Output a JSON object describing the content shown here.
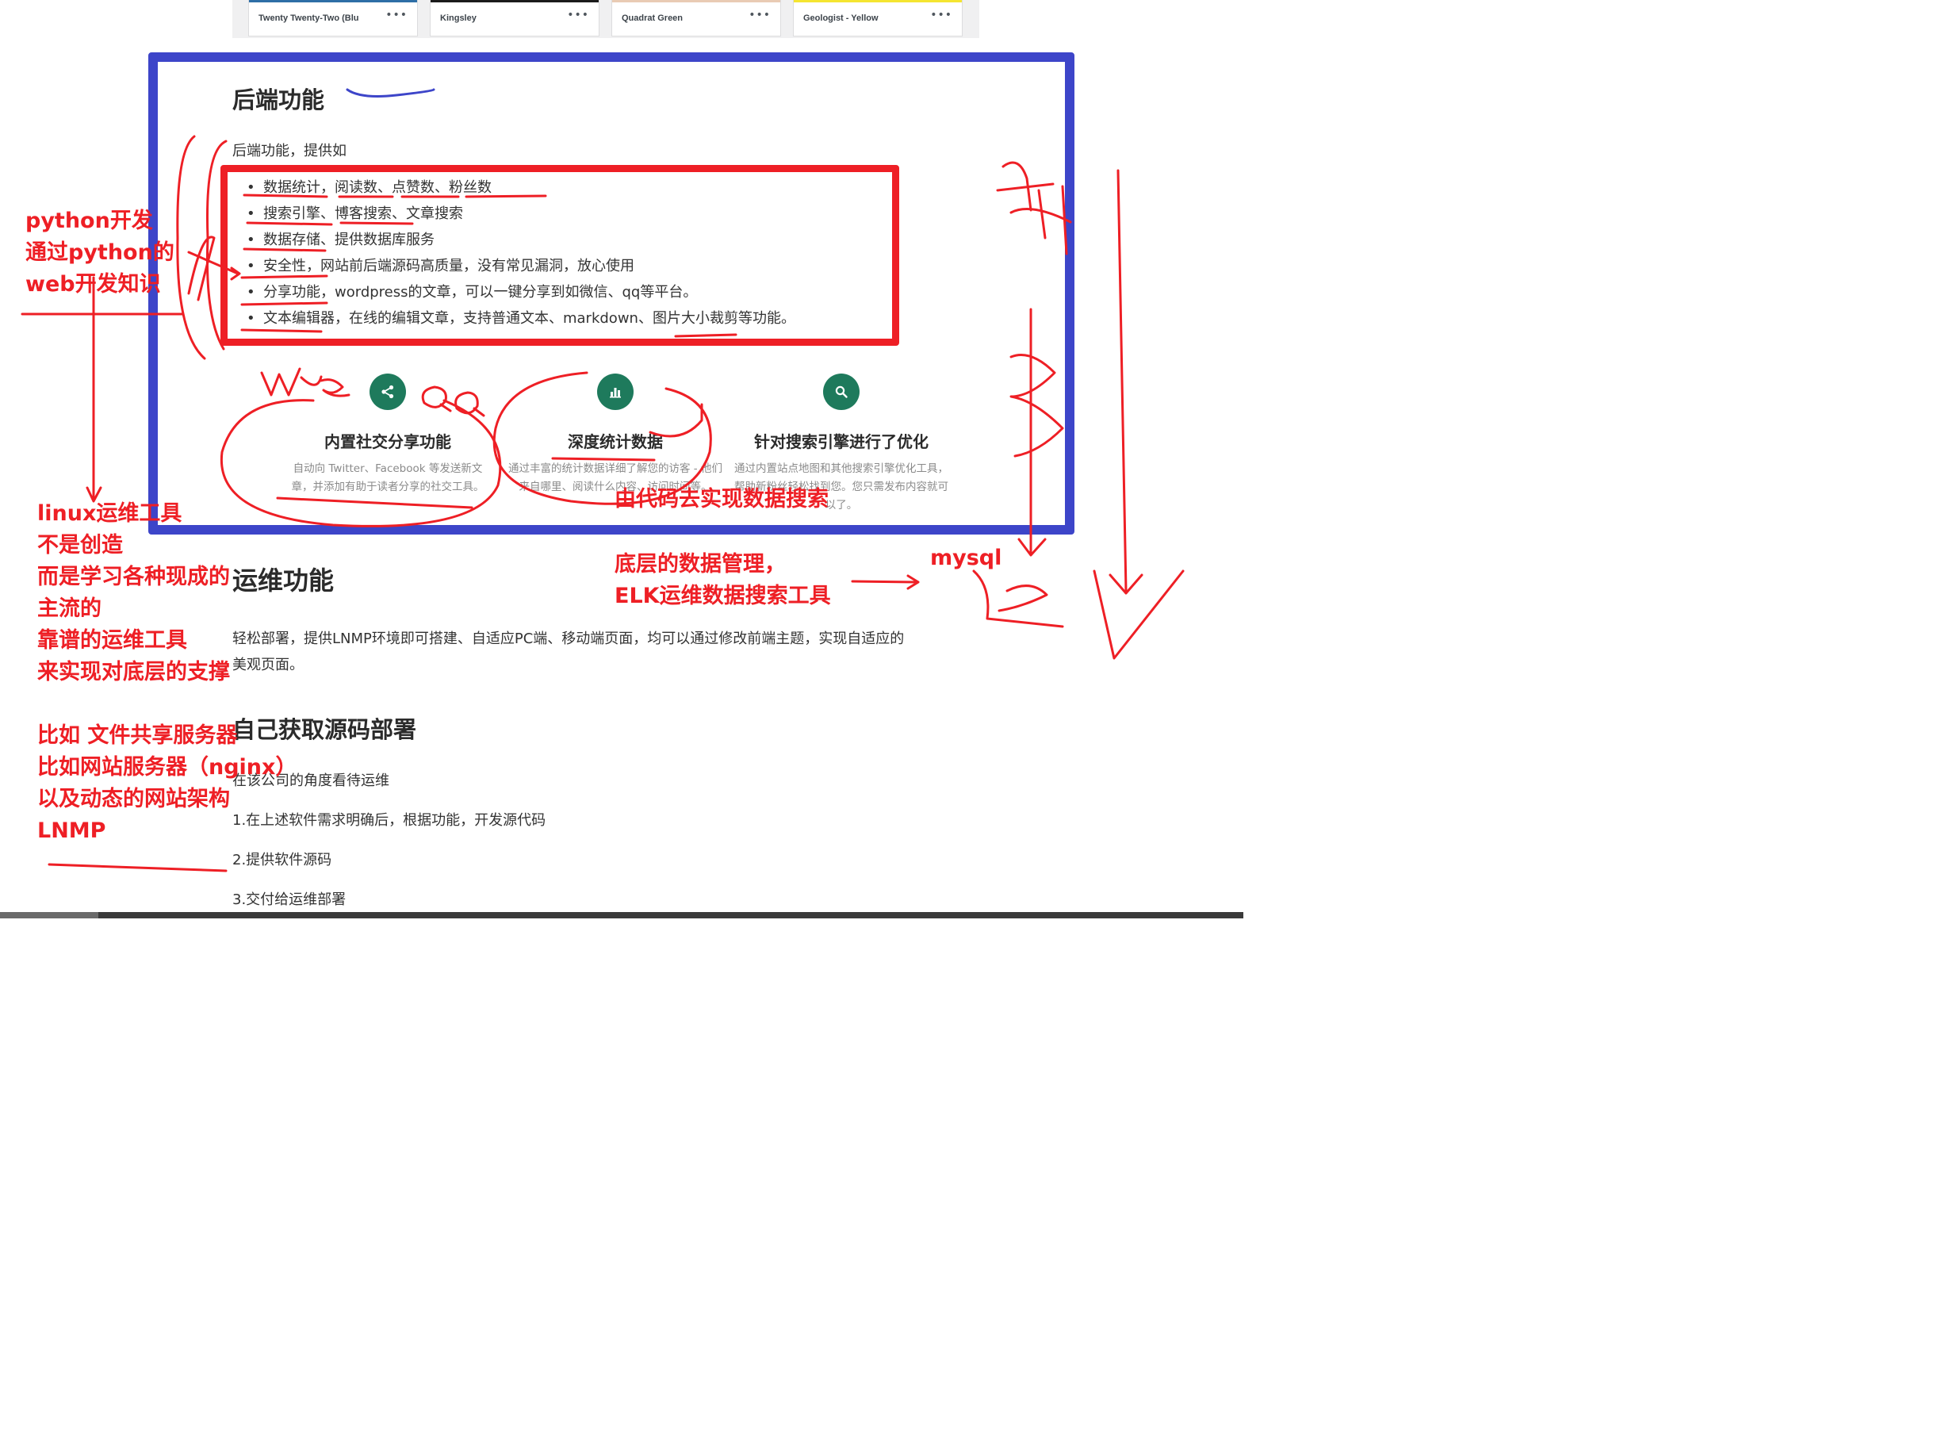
{
  "themes": [
    {
      "name": "Twenty Twenty-Two (Blu",
      "bar": "#2e6ea6"
    },
    {
      "name": "Kingsley",
      "bar": "#1b1b1b"
    },
    {
      "name": "Quadrat Green",
      "bar": "#e9cbb4"
    },
    {
      "name": "Geologist - Yellow",
      "bar": "#f5e531"
    }
  ],
  "theme_more": "•••",
  "backend": {
    "heading": "后端功能",
    "intro": "后端功能，提供如",
    "items": [
      "数据统计，阅读数、点赞数、粉丝数",
      "搜索引擎、博客搜索、文章搜索",
      "数据存储、提供数据库服务",
      "安全性，网站前后端源码高质量，没有常见漏洞，放心使用",
      "分享功能，wordpress的文章，可以一键分享到如微信、qq等平台。",
      "文本编辑器，在线的编辑文章，支持普通文本、markdown、图片大小裁剪等功能。"
    ]
  },
  "features": [
    {
      "icon": "share-icon",
      "title": "内置社交分享功能",
      "desc": "自动向 Twitter、Facebook 等发送新文章，并添加有助于读者分享的社交工具。"
    },
    {
      "icon": "bar-chart-icon",
      "title": "深度统计数据",
      "desc": "通过丰富的统计数据详细了解您的访客 - 他们来自哪里、阅读什么内容、访问时间等。"
    },
    {
      "icon": "search-icon",
      "title": "针对搜索引擎进行了优化",
      "desc": "通过内置站点地图和其他搜索引擎优化工具，帮助新粉丝轻松找到您。您只需发布内容就可以了。"
    }
  ],
  "ops": {
    "heading": "运维功能",
    "text_line1": "轻松部署，提供LNMP环境即可搭建、自适应PC端、移动端页面，均可以通过修改前端主题，实现自适应的",
    "text_line2": "美观页面。"
  },
  "source": {
    "heading": "自己获取源码部署",
    "lines": [
      "在该公司的角度看待运维",
      "1.在上述软件需求明确后，根据功能，开发源代码",
      "2.提供软件源码",
      "3.交付给运维部署"
    ]
  },
  "annotations": {
    "python": [
      "python开发",
      "通过python的",
      "web开发知识"
    ],
    "linux": [
      "linux运维工具",
      "不是创造",
      "而是学习各种现成的",
      "主流的",
      "靠谱的运维工具",
      "来实现对底层的支撑",
      "",
      "比如 文件共享服务器",
      "比如网站服务器（nginx）",
      "以及动态的网站架构",
      "LNMP"
    ],
    "search_code": "由代码去实现数据搜索",
    "data_mgmt": [
      "底层的数据管理，",
      "ELK运维数据搜索工具"
    ],
    "mysql": "mysql"
  },
  "colors": {
    "frame": "#3d45c9",
    "annotation": "#ee1f25",
    "icon_bg": "#1e7a5c"
  }
}
